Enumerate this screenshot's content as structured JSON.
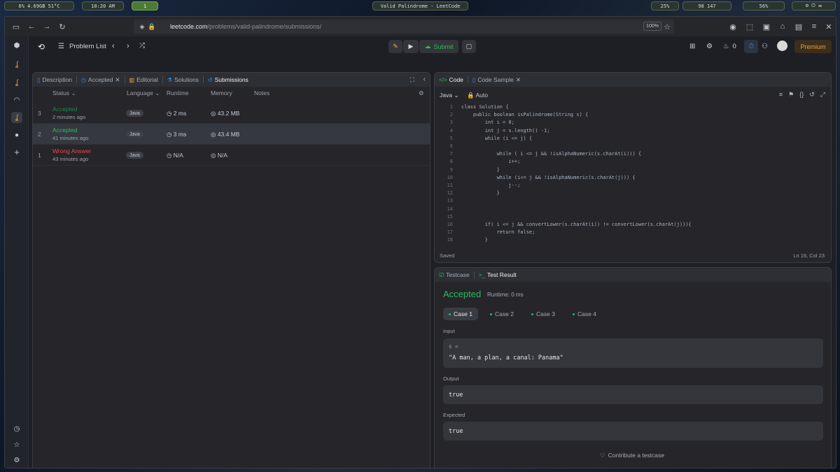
{
  "wm": {
    "stats": "6%  4.69GB  51°C",
    "clock": "10:20 AM",
    "workspace": "1",
    "window_title": "Valid Palindrome - LeetCode",
    "tray_left": "25%",
    "tray_mid": "98   147",
    "tray_batt": "56%"
  },
  "browser": {
    "url_host": "leetcode.com",
    "url_path": "/problems/valid-palindrome/submissions/",
    "zoom": "100%"
  },
  "topbar": {
    "problem_list": "Problem List",
    "submit": "Submit",
    "streak": "0",
    "premium": "Premium"
  },
  "left_tabs": [
    "Description",
    "Accepted",
    "Editorial",
    "Solutions",
    "Submissions"
  ],
  "columns": {
    "status": "Status",
    "language": "Language",
    "runtime": "Runtime",
    "memory": "Memory",
    "notes": "Notes"
  },
  "submissions": [
    {
      "idx": "3",
      "status": "Accepted",
      "ago": "2 minutes ago",
      "lang": "Java",
      "runtime": "2 ms",
      "memory": "43.2 MB"
    },
    {
      "idx": "2",
      "status": "Accepted",
      "ago": "41 minutes ago",
      "lang": "Java",
      "runtime": "3 ms",
      "memory": "43.4 MB"
    },
    {
      "idx": "1",
      "status": "Wrong Answer",
      "ago": "43 minutes ago",
      "lang": "Java",
      "runtime": "N/A",
      "memory": "N/A"
    }
  ],
  "code_tabs": {
    "code": "Code",
    "sample": "Code Sample"
  },
  "editor": {
    "lang": "Java",
    "mode": "Auto",
    "saved": "Saved",
    "cursor": "Ln 16, Col 23",
    "lines": [
      {
        "n": "1",
        "t": "class Solution {"
      },
      {
        "n": "2",
        "t": "    public boolean isPalindrome(String s) {"
      },
      {
        "n": "3",
        "t": "        int i = 0;"
      },
      {
        "n": "4",
        "t": "        int j = s.length() -1;"
      },
      {
        "n": "5",
        "t": "        while (i <= j) {"
      },
      {
        "n": "6",
        "t": ""
      },
      {
        "n": "7",
        "t": "            while ( i <= j && !isAlphaNumeric(s.charAt(i))) {"
      },
      {
        "n": "8",
        "t": "                i++;"
      },
      {
        "n": "9",
        "t": "            }"
      },
      {
        "n": "10",
        "t": "            while (i<= j && !isAlphaNumeric(s.charAt(j))) {"
      },
      {
        "n": "11",
        "t": "                j--;"
      },
      {
        "n": "12",
        "t": "            }"
      },
      {
        "n": "13",
        "t": ""
      },
      {
        "n": "14",
        "t": ""
      },
      {
        "n": "15",
        "t": ""
      },
      {
        "n": "16",
        "t": "        if( i <= j && convertLower(s.charAt(i)) != convertLower(s.charAt(j))){"
      },
      {
        "n": "17",
        "t": "            return false;"
      },
      {
        "n": "18",
        "t": "        }"
      }
    ]
  },
  "result": {
    "tab_testcase": "Testcase",
    "tab_result": "Test Result",
    "verdict": "Accepted",
    "runtime": "Runtime: 0 ms",
    "cases": [
      "Case 1",
      "Case 2",
      "Case 3",
      "Case 4"
    ],
    "input_label": "Input",
    "input_var": "s =",
    "input_value": "\"A man, a plan, a canal: Panama\"",
    "output_label": "Output",
    "output_value": "true",
    "expected_label": "Expected",
    "expected_value": "true",
    "contribute": "Contribute a testcase"
  }
}
